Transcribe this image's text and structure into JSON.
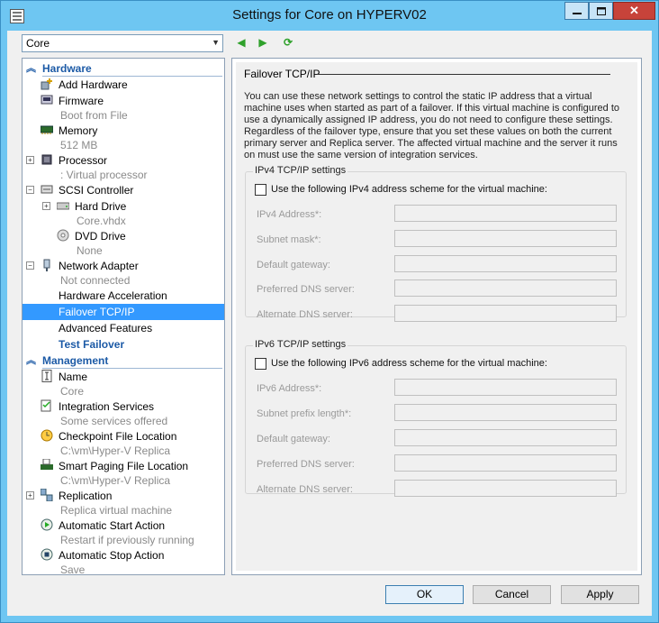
{
  "window": {
    "title": "Settings for Core on HYPERV02"
  },
  "toolbar": {
    "vm_selector": "Core"
  },
  "tree": {
    "hardware_header": "Hardware",
    "management_header": "Management",
    "items": [
      {
        "label": "Add Hardware"
      },
      {
        "label": "Firmware",
        "sub": "Boot from File"
      },
      {
        "label": "Memory",
        "sub": "512 MB"
      },
      {
        "label": "Processor",
        "sub": ": Virtual processor"
      },
      {
        "label": "SCSI Controller"
      },
      {
        "label": "Hard Drive",
        "sub": "Core.vhdx"
      },
      {
        "label": "DVD Drive",
        "sub": "None"
      },
      {
        "label": "Network Adapter",
        "sub": "Not connected"
      },
      {
        "label": "Hardware Acceleration"
      },
      {
        "label": "Failover TCP/IP"
      },
      {
        "label": "Advanced Features"
      },
      {
        "label": "Test Failover"
      },
      {
        "label": "Name",
        "sub": "Core"
      },
      {
        "label": "Integration Services",
        "sub": "Some services offered"
      },
      {
        "label": "Checkpoint File Location",
        "sub": "C:\\vm\\Hyper-V Replica"
      },
      {
        "label": "Smart Paging File Location",
        "sub": "C:\\vm\\Hyper-V Replica"
      },
      {
        "label": "Replication",
        "sub": "Replica virtual machine"
      },
      {
        "label": "Automatic Start Action",
        "sub": "Restart if previously running"
      },
      {
        "label": "Automatic Stop Action",
        "sub": "Save"
      }
    ]
  },
  "panel": {
    "section_title": "Failover TCP/IP",
    "description": "You can use these network settings to control the static IP address that a virtual machine uses when started as part of a failover. If this virtual machine is configured to use a dynamically assigned IP address, you do not need to configure these settings. Regardless of the failover type, ensure that you set these values on both the current primary server and Replica server. The affected virtual machine and the server it runs on must use the same version of integration services.",
    "ipv4": {
      "group_title": "IPv4 TCP/IP settings",
      "checkbox": "Use the following IPv4 address scheme for the virtual machine:",
      "fields": [
        "IPv4 Address*:",
        "Subnet mask*:",
        "Default gateway:",
        "Preferred DNS server:",
        "Alternate DNS server:"
      ]
    },
    "ipv6": {
      "group_title": "IPv6 TCP/IP settings",
      "checkbox": "Use the following IPv6 address scheme for the virtual machine:",
      "fields": [
        "IPv6 Address*:",
        "Subnet prefix length*:",
        "Default gateway:",
        "Preferred DNS server:",
        "Alternate DNS server:"
      ]
    }
  },
  "buttons": {
    "ok": "OK",
    "cancel": "Cancel",
    "apply": "Apply"
  }
}
